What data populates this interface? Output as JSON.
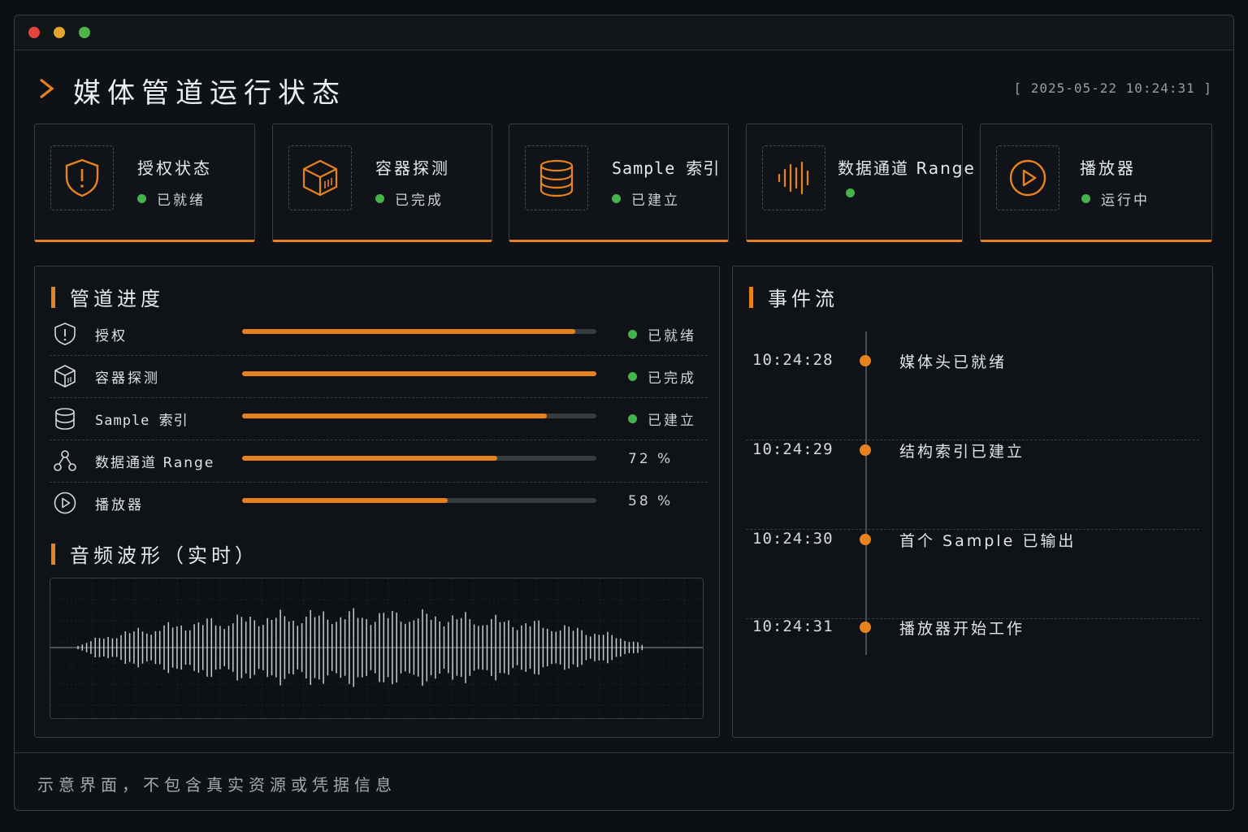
{
  "app": {
    "title": "媒体管道运行状态",
    "timestamp": "[ 2025-05-22 10:24:31 ]"
  },
  "colors": {
    "accent": "#e8821f",
    "ok": "#44b34a",
    "background": "#0e1216"
  },
  "status_cards": [
    {
      "title": "授权状态",
      "status": "已就绪",
      "icon": "shield-alert-icon"
    },
    {
      "title": "容器探测",
      "status": "已完成",
      "icon": "cube-icon"
    },
    {
      "title": "Sample 索引",
      "status": "已建立",
      "icon": "database-icon"
    },
    {
      "title": "数据通道 Range",
      "status": "",
      "icon": "waveform-icon"
    },
    {
      "title": "播放器",
      "status": "运行中",
      "icon": "play-circle-icon"
    }
  ],
  "progress": {
    "title": "管道进度",
    "rows": [
      {
        "label": "授权",
        "icon": "shield-alert-icon",
        "progress": 0.94,
        "status": "已就绪"
      },
      {
        "label": "容器探测",
        "icon": "cube-icon",
        "progress": 1.0,
        "status": "已完成"
      },
      {
        "label": "Sample 索引",
        "icon": "database-icon",
        "progress": 0.86,
        "status": "已建立"
      },
      {
        "label": "数据通道 Range",
        "icon": "network-nodes-icon",
        "progress": 0.72,
        "status": "72 %"
      },
      {
        "label": "播放器",
        "icon": "play-circle-icon",
        "progress": 0.58,
        "status": "58 %"
      }
    ]
  },
  "waveform": {
    "title": "音频波形（实时）"
  },
  "events": {
    "title": "事件流",
    "items": [
      {
        "time": "10:24:28",
        "text": "媒体头已就绪"
      },
      {
        "time": "10:24:29",
        "text": "结构索引已建立"
      },
      {
        "time": "10:24:30",
        "text": "首个 Sample 已输出"
      },
      {
        "time": "10:24:31",
        "text": "播放器开始工作"
      }
    ]
  },
  "footer": {
    "note": "示意界面，不包含真实资源或凭据信息"
  }
}
